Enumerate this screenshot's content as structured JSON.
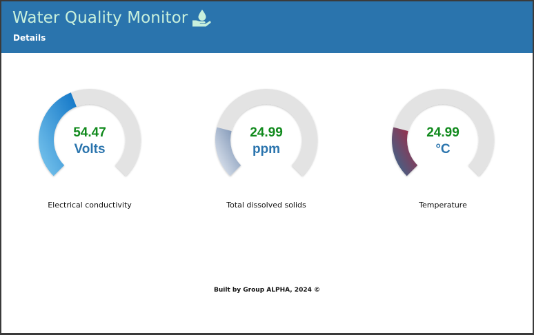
{
  "header": {
    "title": "Water Quality Monitor",
    "title_icon": "water-drop-hand-icon",
    "subtitle": "Details",
    "background": "#2a74ad",
    "title_color": "#c8f0dc"
  },
  "gauges": [
    {
      "value": "54.47",
      "unit": "Volts",
      "label": "Electrical conductivity",
      "fill_fraction": 0.42,
      "gradient": [
        "#7ec9ef",
        "#0f74c6"
      ]
    },
    {
      "value": "24.99",
      "unit": "ppm",
      "label": "Total dissolved solids",
      "fill_fraction": 0.22,
      "gradient": [
        "#eef2f8",
        "#6b85aa"
      ]
    },
    {
      "value": "24.99",
      "unit": "°C",
      "label": "Temperature",
      "fill_fraction": 0.22,
      "gradient": [
        "#2d6f96",
        "#b1213a"
      ]
    }
  ],
  "colors": {
    "value": "#118a1d",
    "unit": "#2a74ad",
    "track": "#e3e3e3"
  },
  "footer": {
    "text": "Built by Group ALPHA, 2024 ©"
  }
}
